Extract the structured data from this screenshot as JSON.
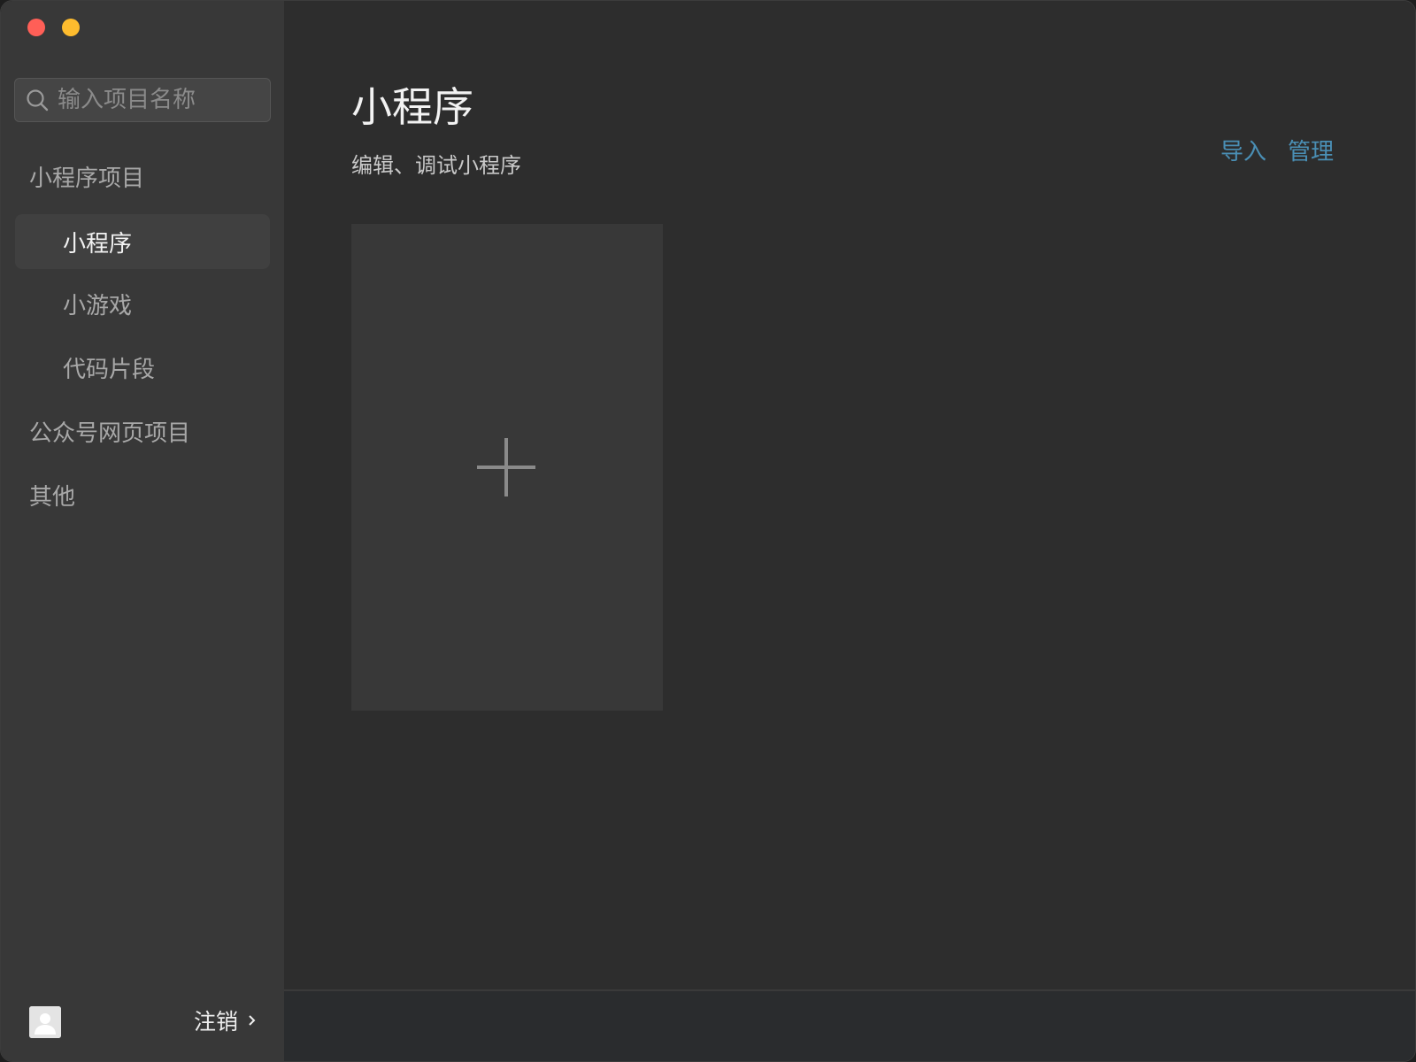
{
  "window": {
    "controls": {
      "close_color": "#ff5f57",
      "minimize_color": "#febc2e"
    }
  },
  "sidebar": {
    "search": {
      "placeholder": "输入项目名称",
      "value": ""
    },
    "groups": [
      {
        "label": "小程序项目",
        "items": [
          {
            "label": "小程序",
            "active": true
          },
          {
            "label": "小游戏",
            "active": false
          },
          {
            "label": "代码片段",
            "active": false
          }
        ]
      },
      {
        "label": "公众号网页项目",
        "items": []
      },
      {
        "label": "其他",
        "items": []
      }
    ],
    "footer": {
      "logout_label": "注销"
    }
  },
  "main": {
    "title": "小程序",
    "subtitle": "编辑、调试小程序",
    "actions": {
      "import_label": "导入",
      "manage_label": "管理"
    },
    "accent_color": "#4a8fb5"
  }
}
